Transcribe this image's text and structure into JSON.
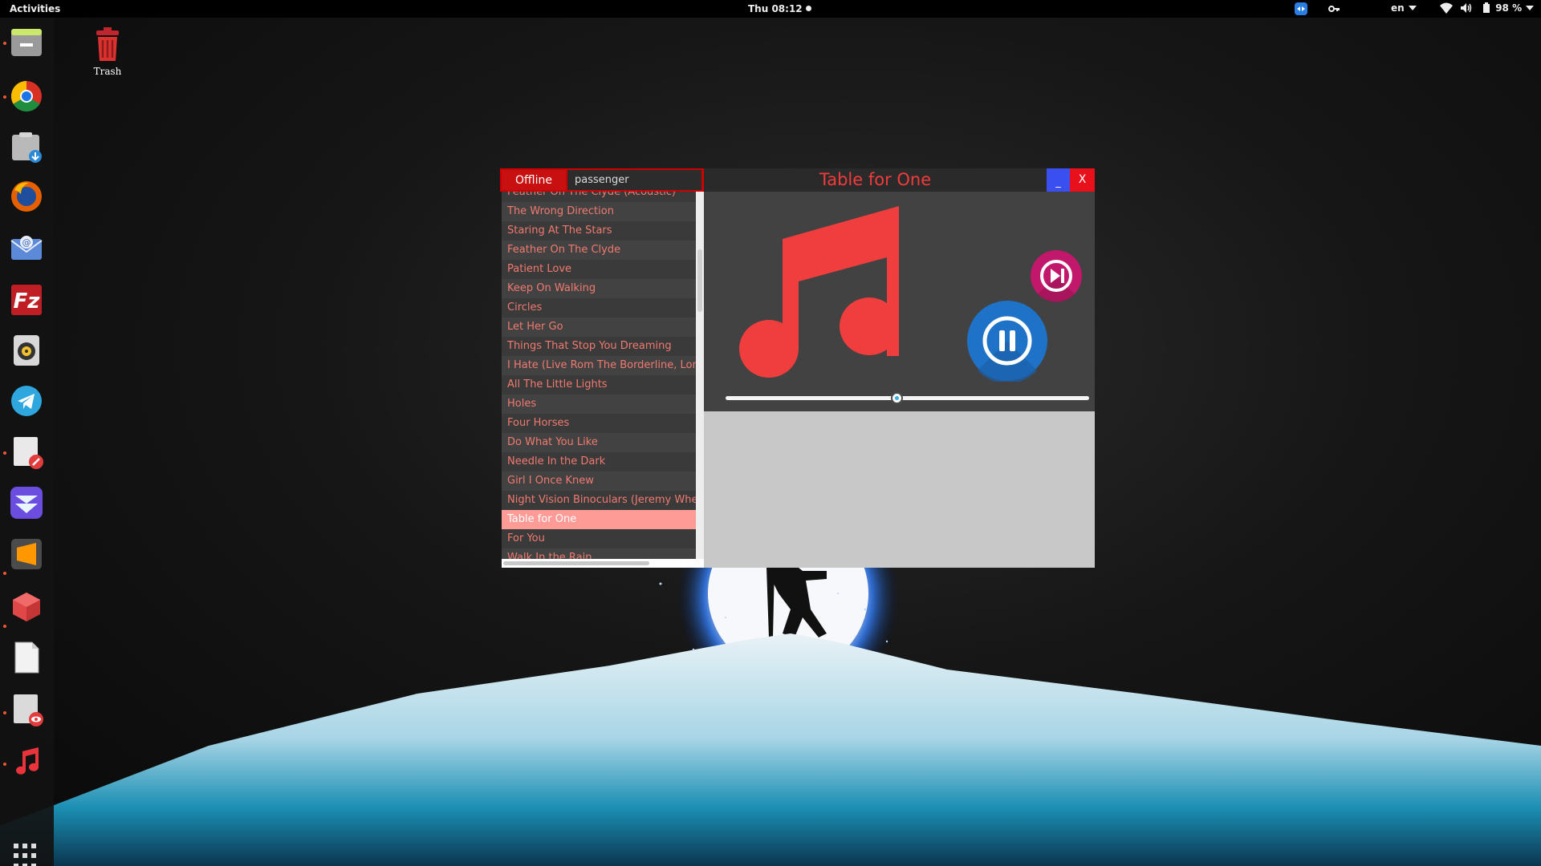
{
  "topbar": {
    "activities": "Activities",
    "clock": "Thu 08:12",
    "language": "en",
    "battery": "98 %"
  },
  "dock": {
    "items": [
      "files-manager",
      "chrome",
      "downloads",
      "firefox",
      "mail",
      "filezilla",
      "rhythmbox",
      "telegram",
      "text-editor",
      "elementary",
      "sublime-text",
      "3d-cube",
      "blank-document",
      "document-viewer",
      "music-player"
    ],
    "show_apps": "show-applications"
  },
  "desktop": {
    "trash_label": "Trash"
  },
  "player": {
    "mode_button": "Offline",
    "search_value": "passenger",
    "now_playing": "Table for One",
    "minimize_label": "_",
    "close_label": "X",
    "songs": [
      "Feather On The Clyde (Acoustic)",
      "The Wrong Direction",
      "Staring At The Stars",
      "Feather On The Clyde",
      "Patient Love",
      "Keep On Walking",
      "Circles",
      "Let Her Go",
      "Things That Stop You Dreaming",
      "I Hate (Live Rom The Borderline, London)",
      "All The Little Lights",
      "Holes",
      "Four Horses",
      "Do What You Like",
      "Needle In the Dark",
      "Girl I Once Knew",
      "Night Vision Binoculars (Jeremy Whelan Remix)",
      "Table for One",
      "For You",
      "Walk In the Rain"
    ],
    "active_index": 17,
    "seek_fraction": 0.47,
    "colors": {
      "accent_red": "#f23b3b",
      "list_text": "#f07a70",
      "active_row": "#ff9b96",
      "pause_blue": "#1e73c9",
      "next_magenta": "#c2186b"
    },
    "icons": {
      "art": "music-note-icon",
      "play_pause": "pause-icon",
      "next": "skip-next-icon"
    }
  }
}
